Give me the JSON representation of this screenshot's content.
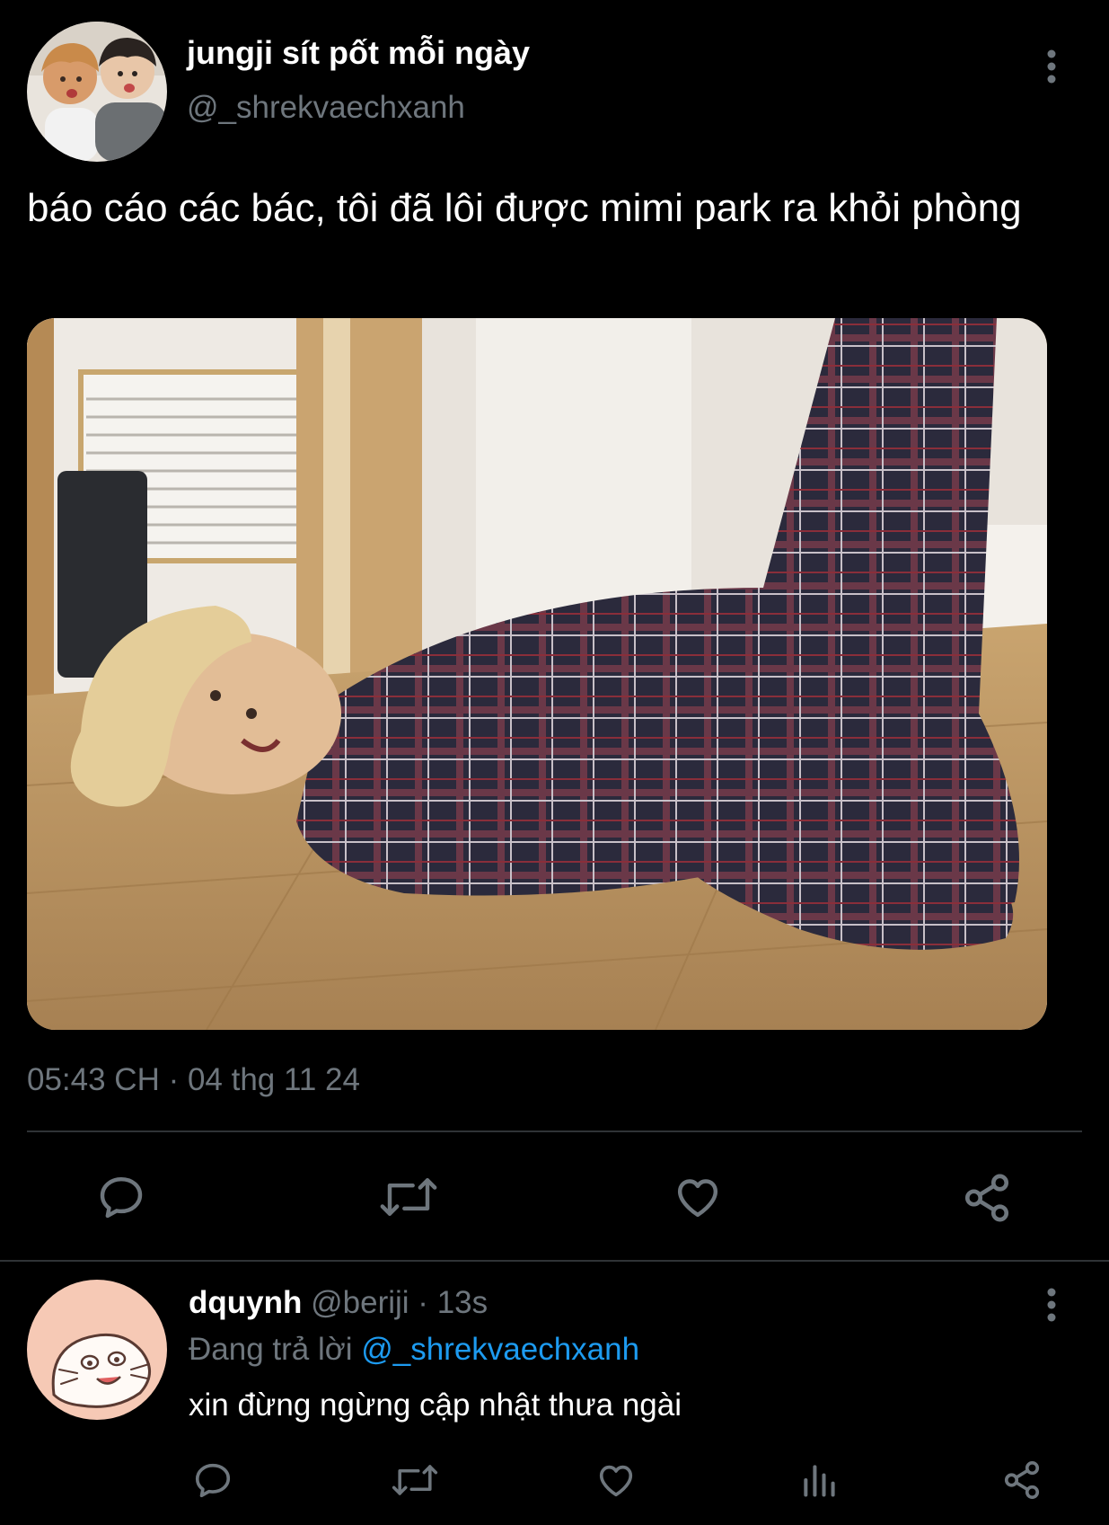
{
  "tweet": {
    "display_name": "jungji sít pốt mỗi ngày",
    "handle": "@_shrekvaechxanh",
    "text": "báo cáo các bác, tôi đã lôi được mimi park ra khỏi phòng",
    "timestamp": "05:43 CH · 04 thg 11 24",
    "avatar_icon": "two-person-avatar",
    "more_icon": "more-vertical-icon",
    "media_description_icon": "photo"
  },
  "actions": {
    "reply_icon": "reply-icon",
    "retweet_icon": "retweet-icon",
    "like_icon": "heart-icon",
    "share_icon": "share-icon"
  },
  "reply": {
    "display_name": "dquynh",
    "handle": "@beriji",
    "separator": "·",
    "time": "13s",
    "replying_prefix": "Đang trả lời",
    "replying_to": "@_shrekvaechxanh",
    "text": "xin đừng ngừng cập nhật thưa ngài",
    "avatar_icon": "seal-cartoon-avatar",
    "actions": [
      "reply-icon",
      "retweet-icon",
      "heart-icon",
      "stats-icon",
      "share-icon"
    ]
  },
  "colors": {
    "background": "#000000",
    "secondary_text": "#6e767d",
    "mention": "#1d9bf0",
    "divider": "#2f3336"
  }
}
